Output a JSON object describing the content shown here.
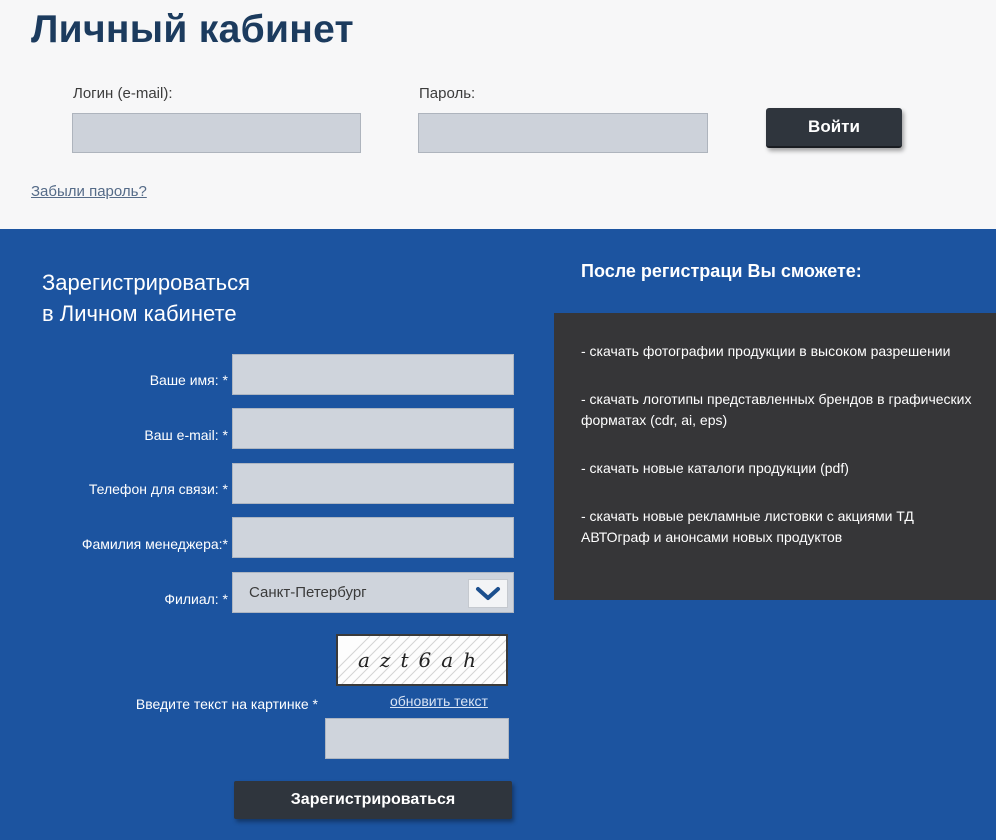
{
  "login": {
    "title": "Личный кабинет",
    "login_label": "Логин (e-mail):",
    "password_label": "Пароль:",
    "login_button": "Войти",
    "forgot_link": "Забыли пароль?"
  },
  "register": {
    "title_line1": "Зарегистрироваться",
    "title_line2": "в Личном кабинете",
    "fields": {
      "name_label": "Ваше имя: *",
      "email_label": "Ваш e-mail: *",
      "phone_label": "Телефон для связи: *",
      "manager_label": "Фамилия менеджера:*",
      "branch_label": "Филиал: *",
      "branch_value": "Санкт-Петербург",
      "captcha_label": "Введите текст на картинке *"
    },
    "captcha_text": "azt6ah",
    "refresh_link": "обновить текст",
    "submit_button": "Зарегистрироваться"
  },
  "benefits": {
    "title": "После регистраци Вы сможете:",
    "items": [
      "- скачать фотографии продукции в высоком разрешении",
      "- скачать логотипы представленных брендов в графических форматах (cdr, ai, eps)",
      "- скачать новые каталоги продукции (pdf)",
      "- скачать новые рекламные листовки с акциями ТД АВТОграф и анонсами новых продуктов"
    ]
  },
  "colors": {
    "accent_blue": "#1c54a0",
    "dark_button": "#2f353d",
    "panel_dark": "#363638",
    "title_navy": "#1c3b5e"
  }
}
